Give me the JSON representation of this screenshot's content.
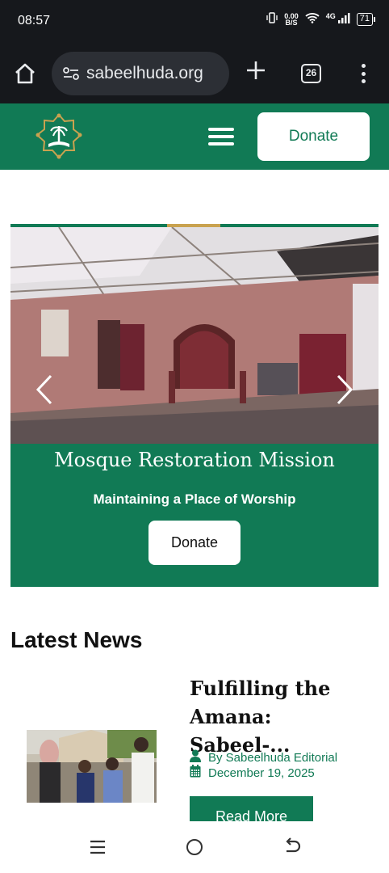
{
  "status_bar": {
    "time": "08:57",
    "net_speed_value": "0.00",
    "net_speed_unit": "B/S",
    "network": "4G",
    "battery": "71"
  },
  "browser": {
    "url": "sabeelhuda.org",
    "tab_count": "26"
  },
  "header": {
    "donate_label": "Donate"
  },
  "slider": {
    "title": "Mosque Restoration Mission",
    "subtitle": "Maintaining a Place of Worship",
    "donate_label": "Donate"
  },
  "news": {
    "heading": "Latest News",
    "items": [
      {
        "title": "Fulfilling the Amana: Sabeel-...",
        "author": "By Sabeelhuda Editorial",
        "date": "December 19, 2025",
        "read_more": "Read More"
      }
    ]
  },
  "colors": {
    "brand_green": "#117a55",
    "accent_gold": "#c9a24f",
    "browser_dark": "#16181c"
  },
  "icons": {
    "home": "home-icon",
    "site_info": "tune-icon",
    "new_tab": "plus-icon",
    "tabs": "tab-count-icon",
    "menu": "kebab-menu-icon",
    "hamburger": "hamburger-icon",
    "prev": "chevron-left-icon",
    "next": "chevron-right-icon",
    "author": "person-icon",
    "date": "calendar-icon"
  }
}
